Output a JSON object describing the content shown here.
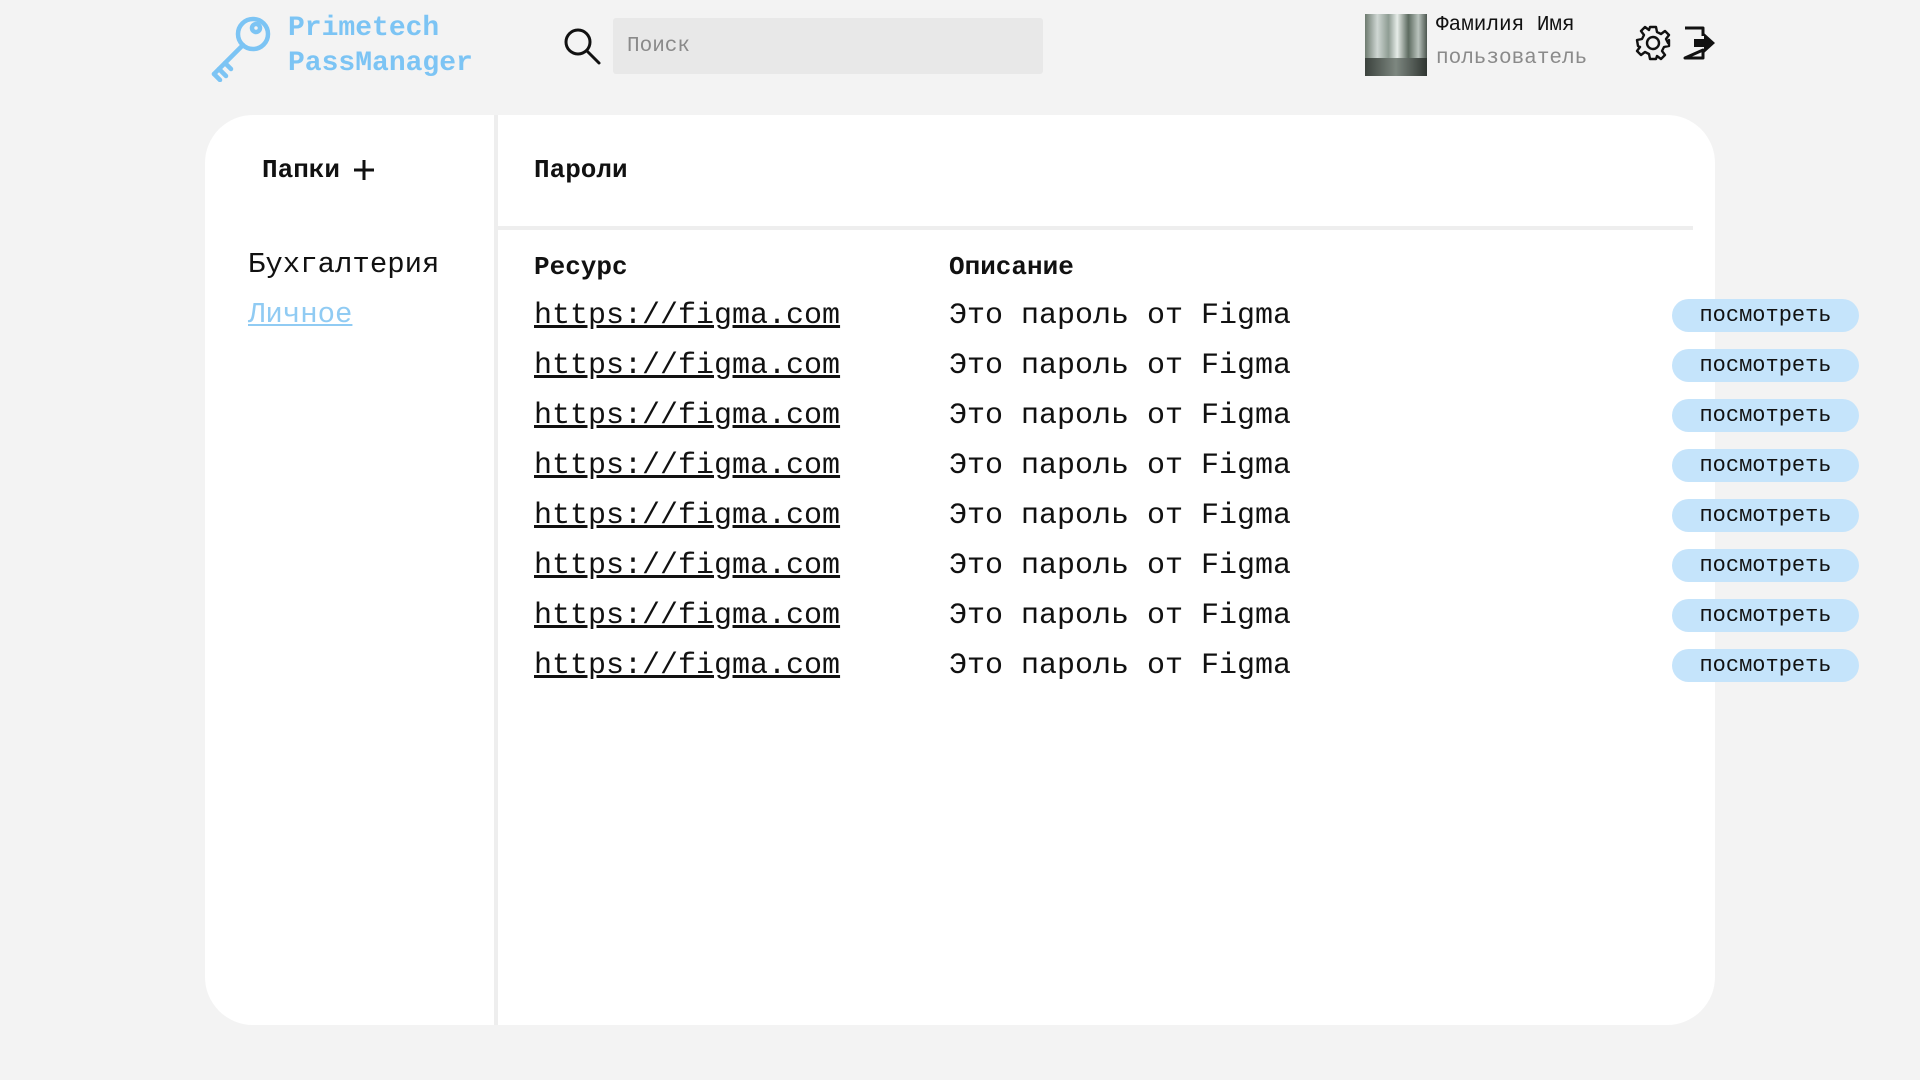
{
  "app": {
    "title_line1": "Primetech",
    "title_line2": "PassManager",
    "accent_color": "#7cc4f4",
    "logo_icon": "key-icon"
  },
  "search": {
    "placeholder": "Поиск",
    "icon": "search-icon"
  },
  "user": {
    "name": "Фамилия Имя",
    "role": "пользователь"
  },
  "header_actions": {
    "settings_icon": "gear-icon",
    "logout_icon": "logout-icon"
  },
  "sidebar": {
    "title": "Папки",
    "add_icon": "plus-icon",
    "folders": [
      {
        "label": "Бухгалтерия",
        "active": false
      },
      {
        "label": "Личное",
        "active": true
      }
    ]
  },
  "passwords": {
    "title": "Пароли",
    "columns": [
      "Ресурс",
      "Описание"
    ],
    "view_label": "посмотреть",
    "rows": [
      {
        "resource": "https://figma.com",
        "description": "Это пароль от Figma"
      },
      {
        "resource": "https://figma.com",
        "description": "Это пароль от Figma"
      },
      {
        "resource": "https://figma.com",
        "description": "Это пароль от Figma"
      },
      {
        "resource": "https://figma.com",
        "description": "Это пароль от Figma"
      },
      {
        "resource": "https://figma.com",
        "description": "Это пароль от Figma"
      },
      {
        "resource": "https://figma.com",
        "description": "Это пароль от Figma"
      },
      {
        "resource": "https://figma.com",
        "description": "Это пароль от Figma"
      },
      {
        "resource": "https://figma.com",
        "description": "Это пароль от Figma"
      }
    ]
  }
}
